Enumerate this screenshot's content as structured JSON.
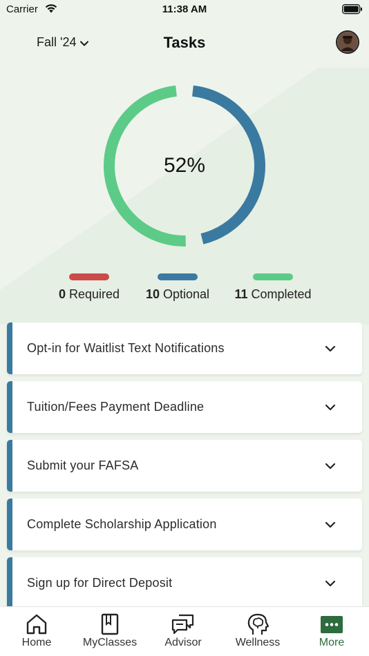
{
  "status_bar": {
    "carrier": "Carrier",
    "time": "11:38 AM"
  },
  "header": {
    "term": "Fall '24",
    "title": "Tasks"
  },
  "progress": {
    "percent_label": "52%",
    "completed_fraction": 0.52
  },
  "legend": [
    {
      "count": "0",
      "label": "Required",
      "color": "#cc4a4a"
    },
    {
      "count": "10",
      "label": "Optional",
      "color": "#3a7aa0"
    },
    {
      "count": "11",
      "label": "Completed",
      "color": "#5ccb87"
    }
  ],
  "tasks": [
    {
      "title": "Opt-in for Waitlist Text Notifications"
    },
    {
      "title": "Tuition/Fees Payment Deadline"
    },
    {
      "title": "Submit your FAFSA"
    },
    {
      "title": "Complete Scholarship Application"
    },
    {
      "title": "Sign up for Direct Deposit"
    }
  ],
  "tab_bar": [
    {
      "label": "Home",
      "icon": "home-icon"
    },
    {
      "label": "MyClasses",
      "icon": "book-icon"
    },
    {
      "label": "Advisor",
      "icon": "chat-bubbles-icon"
    },
    {
      "label": "Wellness",
      "icon": "head-brain-icon"
    },
    {
      "label": "More",
      "icon": "more-dots-icon",
      "active": true
    }
  ],
  "colors": {
    "accent_green": "#2e6b3e",
    "optional_blue": "#3a7aa0",
    "completed_green": "#5ccb87",
    "required_red": "#cc4a4a"
  }
}
